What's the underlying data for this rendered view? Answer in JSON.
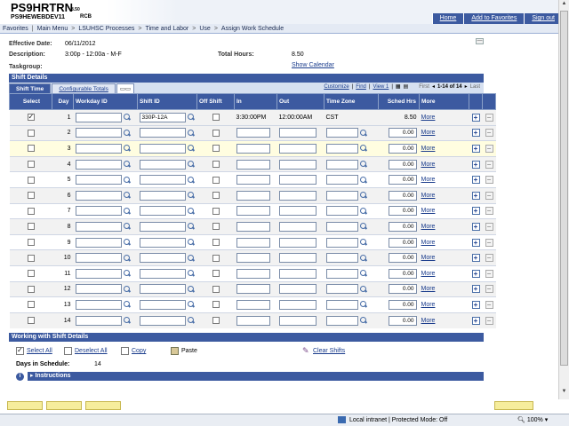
{
  "header": {
    "app_name": "PS9HRTRN",
    "app_version": "8.50",
    "db_name": "PS9HEWEBDEV11",
    "user_code": "RCB",
    "links": [
      "Home",
      "Add to Favorites",
      "Sign out"
    ]
  },
  "breadcrumb": [
    "Favorites",
    "Main Menu",
    "LSUHSC Processes",
    "Time and Labor",
    "Use",
    "Assign Work Schedule"
  ],
  "summary": {
    "effective_date_label": "Effective Date:",
    "effective_date": "06/11/2012",
    "description_label": "Description:",
    "description": "3:00p - 12:00a - M-F",
    "total_hours_label": "Total Hours:",
    "total_hours": "8.50",
    "taskgroup_label": "Taskgroup:",
    "show_calendar": "Show Calendar"
  },
  "grid": {
    "title": "Shift Details",
    "tabs": [
      "Shift Time",
      "Configurable Totals"
    ],
    "nav": {
      "customize": "Customize",
      "find": "Find",
      "view": "View 1",
      "first": "First",
      "range": "1-14 of 14",
      "last": "Last"
    },
    "columns": [
      "Select",
      "Day",
      "Workday ID",
      "Shift ID",
      "Off Shift",
      "In",
      "Out",
      "Time Zone",
      "Sched Hrs",
      "More"
    ],
    "rows": [
      {
        "day": "1",
        "selected": true,
        "workday_id": "",
        "shift_id": "330P-12A",
        "in": "3:30:00PM",
        "out": "12:00:00AM",
        "tz": "CST",
        "hrs": "8.50",
        "more": "More"
      },
      {
        "day": "2",
        "selected": false,
        "workday_id": "",
        "shift_id": "",
        "in": "",
        "out": "",
        "tz": "",
        "hrs": "0.00",
        "more": "More"
      },
      {
        "day": "3",
        "selected": false,
        "workday_id": "",
        "shift_id": "",
        "in": "",
        "out": "",
        "tz": "",
        "hrs": "0.00",
        "more": "More"
      },
      {
        "day": "4",
        "selected": false,
        "workday_id": "",
        "shift_id": "",
        "in": "",
        "out": "",
        "tz": "",
        "hrs": "0.00",
        "more": "More"
      },
      {
        "day": "5",
        "selected": false,
        "workday_id": "",
        "shift_id": "",
        "in": "",
        "out": "",
        "tz": "",
        "hrs": "0.00",
        "more": "More"
      },
      {
        "day": "6",
        "selected": false,
        "workday_id": "",
        "shift_id": "",
        "in": "",
        "out": "",
        "tz": "",
        "hrs": "0.00",
        "more": "More"
      },
      {
        "day": "7",
        "selected": false,
        "workday_id": "",
        "shift_id": "",
        "in": "",
        "out": "",
        "tz": "",
        "hrs": "0.00",
        "more": "More"
      },
      {
        "day": "8",
        "selected": false,
        "workday_id": "",
        "shift_id": "",
        "in": "",
        "out": "",
        "tz": "",
        "hrs": "0.00",
        "more": "More"
      },
      {
        "day": "9",
        "selected": false,
        "workday_id": "",
        "shift_id": "",
        "in": "",
        "out": "",
        "tz": "",
        "hrs": "0.00",
        "more": "More"
      },
      {
        "day": "10",
        "selected": false,
        "workday_id": "",
        "shift_id": "",
        "in": "",
        "out": "",
        "tz": "",
        "hrs": "0.00",
        "more": "More"
      },
      {
        "day": "11",
        "selected": false,
        "workday_id": "",
        "shift_id": "",
        "in": "",
        "out": "",
        "tz": "",
        "hrs": "0.00",
        "more": "More"
      },
      {
        "day": "12",
        "selected": false,
        "workday_id": "",
        "shift_id": "",
        "in": "",
        "out": "",
        "tz": "",
        "hrs": "0.00",
        "more": "More"
      },
      {
        "day": "13",
        "selected": false,
        "workday_id": "",
        "shift_id": "",
        "in": "",
        "out": "",
        "tz": "",
        "hrs": "0.00",
        "more": "More"
      },
      {
        "day": "14",
        "selected": false,
        "workday_id": "",
        "shift_id": "",
        "in": "",
        "out": "",
        "tz": "",
        "hrs": "0.00",
        "more": "More"
      }
    ]
  },
  "working": {
    "title": "Working with Shift Details",
    "select_all": "Select All",
    "deselect_all": "Deselect All",
    "copy": "Copy",
    "paste": "Paste",
    "clear_shifts": "Clear Shifts",
    "days_label": "Days in Schedule:",
    "days_value": "14",
    "instructions": "Instructions"
  },
  "statusbar": {
    "zone": "Local intranet | Protected Mode: Off",
    "zoom": "100%"
  },
  "colors": {
    "header_blue": "#3c5aa0",
    "highlight_row": "#fffde0",
    "link": "#1a3c8c"
  }
}
